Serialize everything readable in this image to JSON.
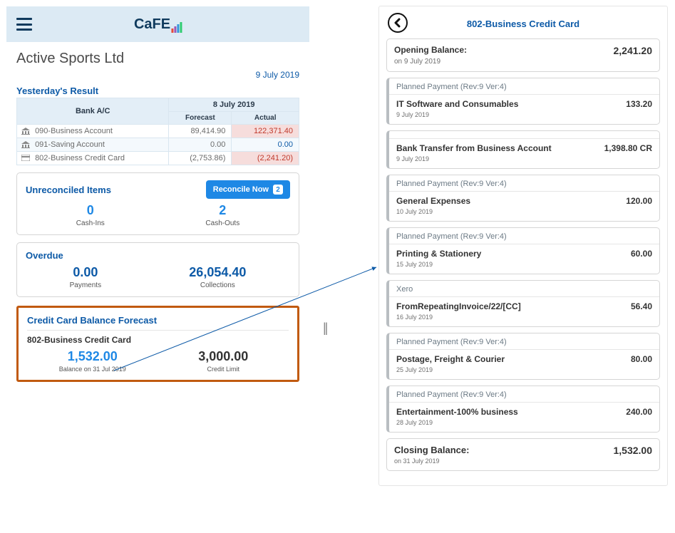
{
  "left": {
    "logo_text": "CaFE",
    "company": "Active Sports Ltd",
    "report_date": "9 July 2019",
    "yesterday": {
      "title": "Yesterday's Result",
      "date": "8 July 2019",
      "col_bank": "Bank A/C",
      "col_forecast": "Forecast",
      "col_actual": "Actual",
      "rows": [
        {
          "name": "090-Business Account",
          "forecast": "89,414.90",
          "actual": "122,371.40"
        },
        {
          "name": "091-Saving Account",
          "forecast": "0.00",
          "actual": "0.00"
        },
        {
          "name": "802-Business Credit Card",
          "forecast": "(2,753.86)",
          "actual": "(2,241.20)"
        }
      ]
    },
    "unreconciled": {
      "title": "Unreconciled Items",
      "btn": "Reconcile Now",
      "btn_count": "2",
      "cash_ins_val": "0",
      "cash_ins_lbl": "Cash-Ins",
      "cash_outs_val": "2",
      "cash_outs_lbl": "Cash-Outs"
    },
    "overdue": {
      "title": "Overdue",
      "payments_val": "0.00",
      "payments_lbl": "Payments",
      "collections_val": "26,054.40",
      "collections_lbl": "Collections"
    },
    "forecast": {
      "title": "Credit Card Balance Forecast",
      "account": "802-Business Credit Card",
      "balance_val": "1,532.00",
      "balance_lbl": "Balance on 31 Jul 2019",
      "limit_val": "3,000.00",
      "limit_lbl": "Credit Limit"
    }
  },
  "right": {
    "title": "802-Business Credit Card",
    "opening": {
      "label": "Opening Balance:",
      "date": "on 9 July 2019",
      "amount": "2,241.20"
    },
    "closing": {
      "label": "Closing Balance:",
      "date": "on 31 July 2019",
      "amount": "1,532.00"
    },
    "sections": [
      {
        "head": "Planned Payment (Rev:9 Ver:4)",
        "desc": "IT Software and Consumables",
        "date": "9 July 2019",
        "amount": "133.20"
      },
      {
        "head": "",
        "desc": "Bank Transfer from Business Account",
        "date": "9 July 2019",
        "amount": "1,398.80 CR"
      },
      {
        "head": "Planned Payment (Rev:9 Ver:4)",
        "desc": "General Expenses",
        "date": "10 July 2019",
        "amount": "120.00"
      },
      {
        "head": "Planned Payment (Rev:9 Ver:4)",
        "desc": "Printing & Stationery",
        "date": "15 July 2019",
        "amount": "60.00"
      },
      {
        "head": "Xero",
        "desc": "FromRepeatingInvoice/22/[CC]",
        "date": "16 July 2019",
        "amount": "56.40"
      },
      {
        "head": "Planned Payment (Rev:9 Ver:4)",
        "desc": "Postage, Freight & Courier",
        "date": "25 July 2019",
        "amount": "80.00"
      },
      {
        "head": "Planned Payment (Rev:9 Ver:4)",
        "desc": "Entertainment-100% business",
        "date": "28 July 2019",
        "amount": "240.00"
      }
    ]
  }
}
